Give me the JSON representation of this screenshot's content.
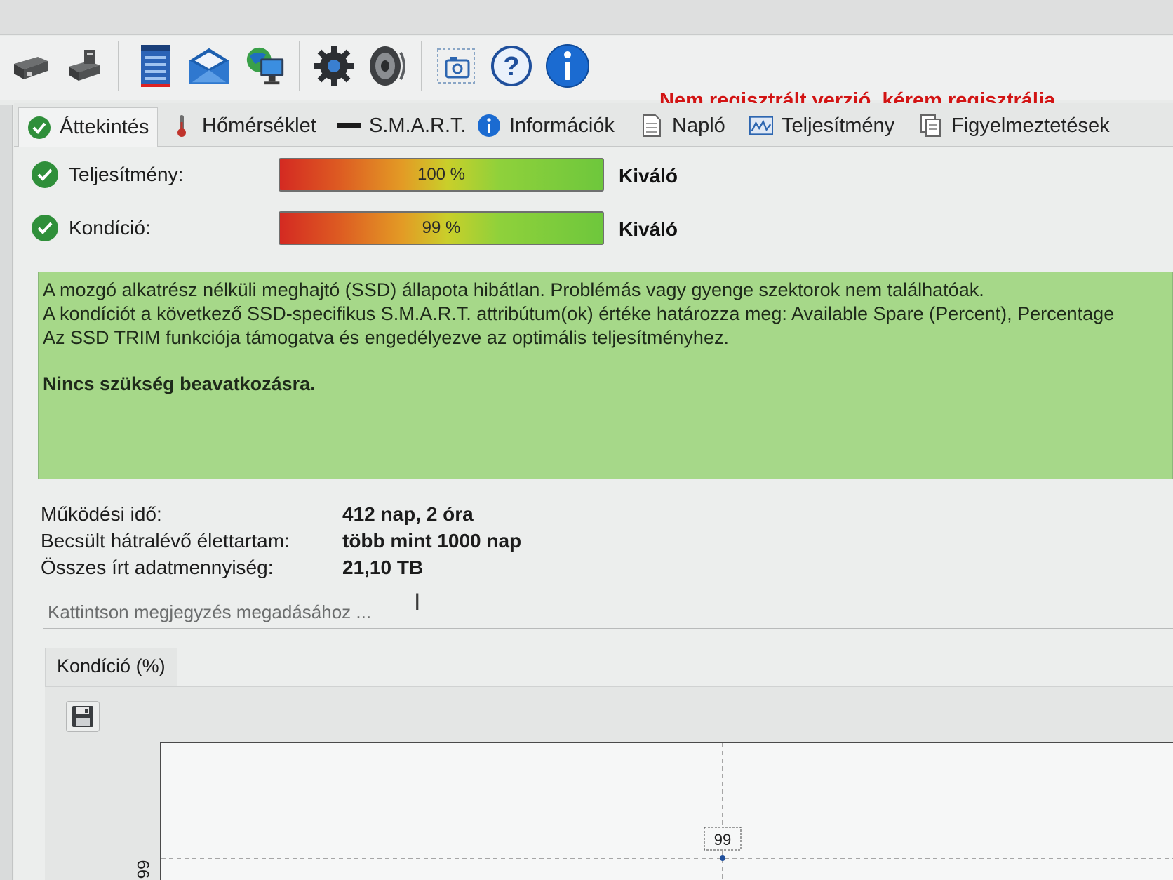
{
  "toolbar": {
    "icons": [
      "drive-icon",
      "drive-warning-icon",
      "notepad-icon",
      "mail-icon",
      "network-globe-icon",
      "settings-gear-icon",
      "speaker-icon",
      "screenshot-camera-icon",
      "help-icon",
      "info-icon"
    ],
    "register_link": "Nem regisztrált verzió, kérem regisztrálja."
  },
  "tabs": [
    {
      "label": "Áttekintés",
      "icon": "check-icon"
    },
    {
      "label": "Hőmérséklet",
      "icon": "thermometer-icon"
    },
    {
      "label": "S.M.A.R.T.",
      "icon": "drive-bar-icon"
    },
    {
      "label": "Információk",
      "icon": "info-icon"
    },
    {
      "label": "Napló",
      "icon": "document-icon"
    },
    {
      "label": "Teljesítmény",
      "icon": "performance-chart-icon"
    },
    {
      "label": "Figyelmeztetések",
      "icon": "alerts-document-icon"
    }
  ],
  "metrics": [
    {
      "label": "Teljesítmény:",
      "value_text": "100 %",
      "value": 100,
      "rating": "Kiváló"
    },
    {
      "label": "Kondíció:",
      "value_text": "99 %",
      "value": 99,
      "rating": "Kiváló"
    }
  ],
  "status": {
    "lines": [
      "A mozgó alkatrész nélküli meghajtó (SSD) állapota hibátlan. Problémás vagy gyenge szektorok nem találhatóak.",
      "A kondíciót a következő SSD-specifikus S.M.A.R.T. attribútum(ok) értéke határozza meg:  Available Spare (Percent), Percentage",
      "Az SSD TRIM funkciója támogatva és engedélyezve az optimális teljesítményhez."
    ],
    "conclusion": "Nincs szükség beavatkozásra.",
    "color": "#a6d889"
  },
  "info": {
    "uptime_label": "Működési idő:",
    "uptime_value": "412 nap, 2 óra",
    "lifetime_label": "Becsült hátralévő élettartam:",
    "lifetime_value": "több mint 1000 nap",
    "written_label": "Összes írt adatmennyiség:",
    "written_value": "21,10 TB"
  },
  "note": {
    "placeholder": "Kattintson megjegyzés megadásához ..."
  },
  "chart": {
    "tab_label": "Kondíció  (%)",
    "save_icon": "save-icon"
  },
  "chart_data": {
    "type": "line",
    "title": "Kondíció  (%)",
    "x": [
      ""
    ],
    "series": [
      {
        "name": "Kondíció",
        "values": [
          99
        ]
      }
    ],
    "y_tick_labels": [
      "99"
    ],
    "data_labels": [
      "99"
    ],
    "grid": true
  },
  "colors": {
    "register_link": "#d21414",
    "ok_green": "#2f8f3a",
    "bar_low": "#d42a22",
    "bar_high": "#6ec73c"
  }
}
